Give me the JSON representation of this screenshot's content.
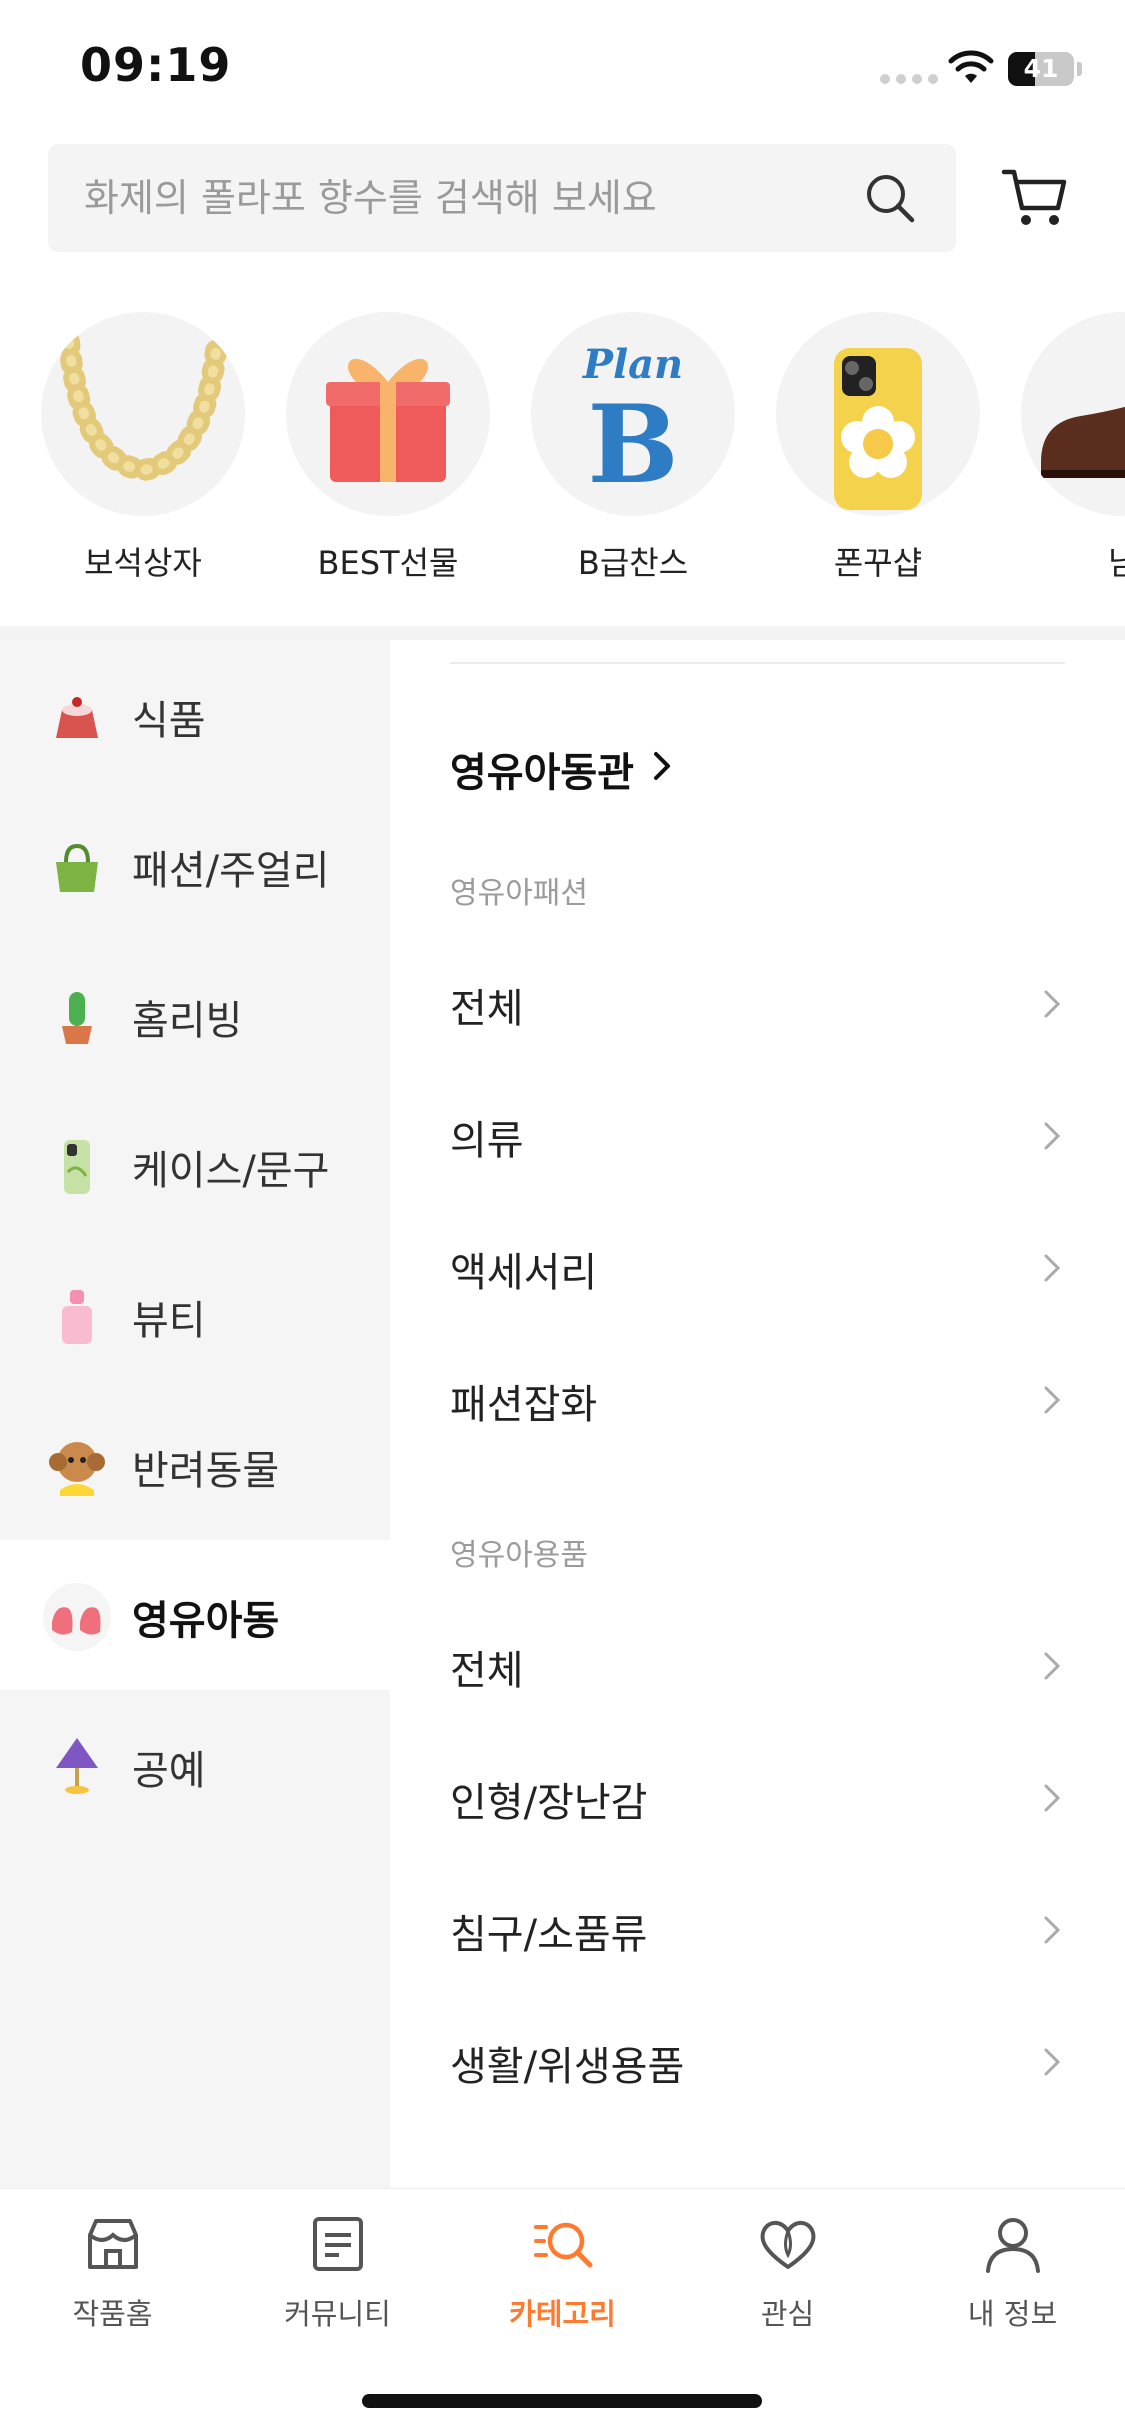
{
  "status_bar": {
    "time": "09:19",
    "battery_percent": "41",
    "battery_level": 0.41
  },
  "search": {
    "placeholder": "화제의 폴라포 향수를 검색해 보세요"
  },
  "quick_categories": [
    {
      "label": "보석상자",
      "icon": "necklace-image"
    },
    {
      "label": "BEST선물",
      "icon": "gift-box-image"
    },
    {
      "label": "B급찬스",
      "icon": "plan-b-logo",
      "logo_text": "Plan",
      "logo_letter": "B"
    },
    {
      "label": "폰꾸샵",
      "icon": "phone-case-image"
    },
    {
      "label": "남",
      "icon": "dress-shoe-image"
    }
  ],
  "categories": [
    {
      "label": "식품",
      "icon": "cake-icon"
    },
    {
      "label": "패션/주얼리",
      "icon": "bag-icon"
    },
    {
      "label": "홈리빙",
      "icon": "cactus-icon"
    },
    {
      "label": "케이스/문구",
      "icon": "phone-case-icon"
    },
    {
      "label": "뷰티",
      "icon": "perfume-icon"
    },
    {
      "label": "반려동물",
      "icon": "dog-icon"
    },
    {
      "label": "영유아동",
      "icon": "baby-shoes-icon",
      "active": true
    },
    {
      "label": "공예",
      "icon": "lamp-icon"
    }
  ],
  "submenu": {
    "title": "영유아동관",
    "groups": [
      {
        "label": "영유아패션",
        "items": [
          "전체",
          "의류",
          "액세서리",
          "패션잡화"
        ]
      },
      {
        "label": "영유아용품",
        "items": [
          "전체",
          "인형/장난감",
          "침구/소품류",
          "생활/위생용품"
        ]
      }
    ]
  },
  "tabs": [
    {
      "label": "작품홈",
      "icon": "shop-icon",
      "active": false
    },
    {
      "label": "커뮤니티",
      "icon": "document-icon",
      "active": false
    },
    {
      "label": "카테고리",
      "icon": "category-search-icon",
      "active": true
    },
    {
      "label": "관심",
      "icon": "heart-icon",
      "active": false
    },
    {
      "label": "내 정보",
      "icon": "person-icon",
      "active": false
    }
  ],
  "colors": {
    "accent": "#ff7a2e",
    "menu_bg": "#f5f5f5",
    "text": "#222222"
  }
}
